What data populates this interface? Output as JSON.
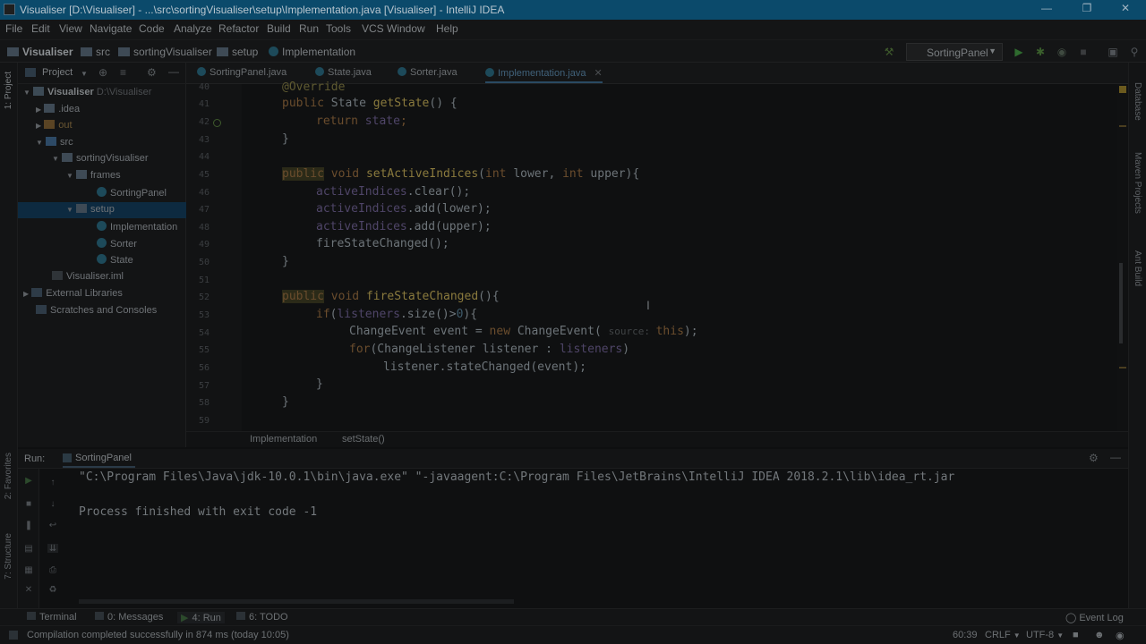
{
  "window": {
    "title": "Visualiser [D:\\Visualiser] - ...\\src\\sortingVisualiser\\setup\\Implementation.java [Visualiser] - IntelliJ IDEA"
  },
  "menu": [
    "File",
    "Edit",
    "View",
    "Navigate",
    "Code",
    "Analyze",
    "Refactor",
    "Build",
    "Run",
    "Tools",
    "VCS",
    "Window",
    "Help"
  ],
  "nav": {
    "crumbs": [
      "Visualiser",
      "src",
      "sortingVisualiser",
      "setup",
      "Implementation"
    ],
    "run_config": "SortingPanel"
  },
  "project": {
    "header": "Project",
    "tree": [
      {
        "label": "Visualiser",
        "suffix": "D:\\Visualiser",
        "icon": "folder-icon"
      },
      {
        "label": ".idea",
        "icon": "folder-icon"
      },
      {
        "label": "out",
        "icon": "folder-icon"
      },
      {
        "label": "src",
        "icon": "folder-icon"
      },
      {
        "label": "sortingVisualiser",
        "icon": "package-icon"
      },
      {
        "label": "frames",
        "icon": "package-icon"
      },
      {
        "label": "SortingPanel",
        "icon": "class-icon"
      },
      {
        "label": "setup",
        "icon": "package-icon"
      },
      {
        "label": "Implementation",
        "icon": "class-icon"
      },
      {
        "label": "Sorter",
        "icon": "class-icon"
      },
      {
        "label": "State",
        "icon": "class-icon"
      },
      {
        "label": "Visualiser.iml",
        "icon": "file-icon"
      },
      {
        "label": "External Libraries",
        "icon": "library-icon"
      },
      {
        "label": "Scratches and Consoles",
        "icon": "scratch-icon"
      }
    ]
  },
  "tabs": [
    "SortingPanel.java",
    "State.java",
    "Sorter.java",
    "Implementation.java"
  ],
  "active_tab": "Implementation.java",
  "line_numbers": [
    "40",
    "41",
    "42",
    "43",
    "44",
    "45",
    "46",
    "47",
    "48",
    "49",
    "50",
    "51",
    "52",
    "53",
    "54",
    "55",
    "56",
    "57",
    "58",
    "59"
  ],
  "code": {
    "l40": "@Override",
    "l41a": "public",
    "l41b": " State ",
    "l41c": "getState",
    "l41d": "() {",
    "l42a": "return ",
    "l42b": "state",
    "l42c": ";",
    "l43": "}",
    "l45a": "public",
    "l45b": " void ",
    "l45c": "setActiveIndices",
    "l45d": "(",
    "l45e": "int ",
    "l45f": "lower, ",
    "l45g": "int ",
    "l45h": "upper){",
    "l46a": "activeIndices",
    "l46b": ".clear();",
    "l47a": "activeIndices",
    "l47b": ".add(lower);",
    "l48a": "activeIndices",
    "l48b": ".add(upper);",
    "l49": "fireStateChanged();",
    "l50": "}",
    "l52a": "public",
    "l52b": " void ",
    "l52c": "fireStateChanged",
    "l52d": "(){",
    "l53a": "if",
    "l53b": "(",
    "l53c": "listeners",
    "l53d": ".size()>",
    "l53e": "0",
    "l53f": "){",
    "l54a": "ChangeEvent event = ",
    "l54b": "new ",
    "l54c": "ChangeEvent( ",
    "l54d": "source: ",
    "l54e": "this",
    "l54f": ");",
    "l55a": "for",
    "l55b": "(ChangeListener listener : ",
    "l55c": "listeners",
    "l55d": ")",
    "l56": "listener.stateChanged(event);",
    "l57": "}",
    "l58": "}"
  },
  "editor_crumbs": [
    "Implementation",
    "setState()"
  ],
  "run": {
    "label": "Run:",
    "config": "SortingPanel",
    "line1": "\"C:\\Program Files\\Java\\jdk-10.0.1\\bin\\java.exe\" \"-javaagent:C:\\Program Files\\JetBrains\\IntelliJ IDEA 2018.2.1\\lib\\idea_rt.jar",
    "line2": "Process finished with exit code -1"
  },
  "bottom_tabs": [
    "Terminal",
    "0: Messages",
    "4: Run",
    "6: TODO"
  ],
  "event_log": "Event Log",
  "status": {
    "message": "Compilation completed successfully in 874 ms (today 10:05)",
    "position": "60:39",
    "line_sep": "CRLF",
    "encoding": "UTF-8"
  },
  "side_left": [
    "1: Project",
    "2: Favorites",
    "7: Structure"
  ],
  "side_right": [
    "Database",
    "Maven Projects",
    "Ant Build"
  ]
}
